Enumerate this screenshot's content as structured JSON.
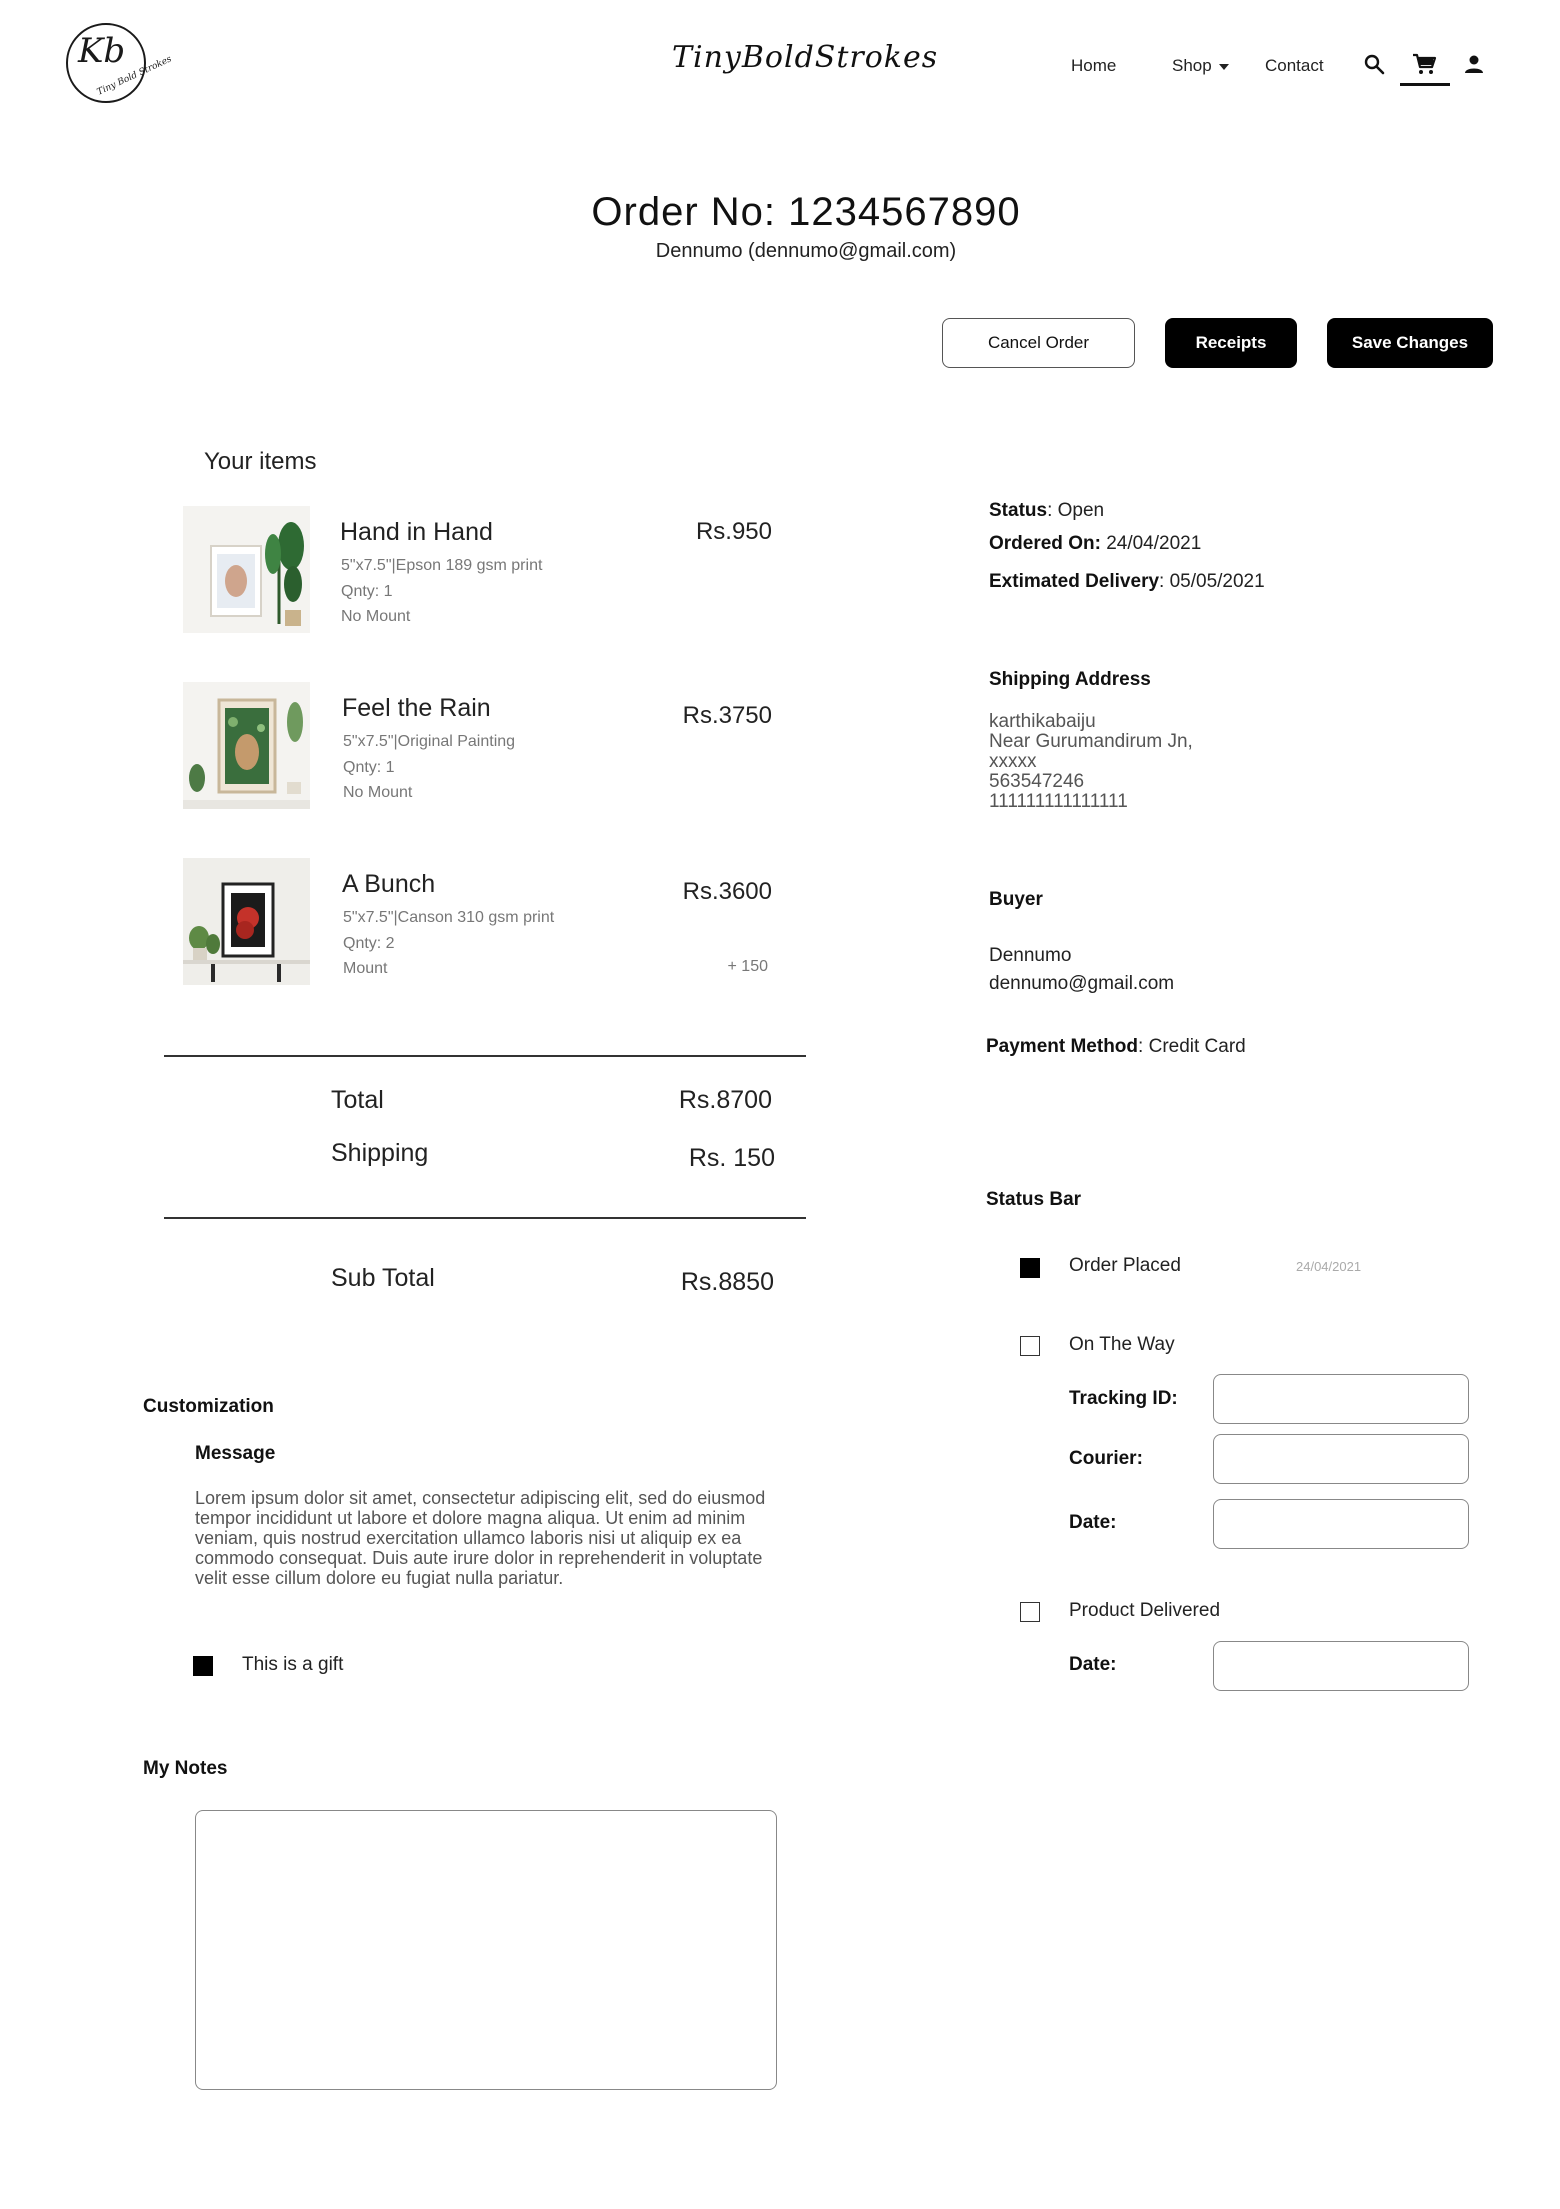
{
  "header": {
    "logo_monogram": "Kb",
    "logo_subtext": "Tiny Bold Strokes",
    "brand": "TinyBoldStrokes",
    "nav": {
      "home": "Home",
      "shop": "Shop",
      "contact": "Contact"
    },
    "icons": [
      "search-icon",
      "cart-icon",
      "user-icon"
    ]
  },
  "order": {
    "title": "Order No: 1234567890",
    "customer_line": "Dennumo (dennumo@gmail.com)"
  },
  "actions": {
    "cancel": "Cancel Order",
    "receipts": "Receipts",
    "save": "Save Changes"
  },
  "items_section": {
    "heading": "Your items",
    "items": [
      {
        "name": "Hand in Hand",
        "spec": "5\"x7.5\"|Epson 189 gsm print",
        "qty": "Qnty: 1",
        "mount": "No Mount",
        "price": "Rs.950",
        "extra": ""
      },
      {
        "name": "Feel the Rain",
        "spec": "5\"x7.5\"|Original Painting",
        "qty": "Qnty: 1",
        "mount": "No Mount",
        "price": "Rs.3750",
        "extra": ""
      },
      {
        "name": "A Bunch",
        "spec": "5\"x7.5\"|Canson 310 gsm print",
        "qty": "Qnty: 2",
        "mount": "Mount",
        "price": "Rs.3600",
        "extra": "+ 150"
      }
    ]
  },
  "totals": {
    "total_label": "Total",
    "total_value": "Rs.8700",
    "shipping_label": "Shipping",
    "shipping_value": "Rs. 150",
    "subtotal_label": "Sub Total",
    "subtotal_value": "Rs.8850"
  },
  "status_info": {
    "status_label": "Status",
    "status_value": "Open",
    "ordered_label": "Ordered On:",
    "ordered_value": "24/04/2021",
    "delivery_label": "Extimated Delivery",
    "delivery_value": "05/05/2021"
  },
  "shipping_address": {
    "heading": "Shipping Address",
    "name": "karthikabaiju",
    "line1": "Near Gurumandirum Jn,",
    "line2": "xxxxx",
    "pincode": "563547246",
    "phone": "111111111111111"
  },
  "buyer": {
    "heading": "Buyer",
    "name": "Dennumo",
    "email": "dennumo@gmail.com"
  },
  "payment": {
    "label": "Payment Method",
    "value": "Credit Card"
  },
  "status_bar": {
    "heading": "Status Bar",
    "order_placed": {
      "label": "Order Placed",
      "date": "24/04/2021",
      "checked": true
    },
    "on_the_way": {
      "label": "On The Way",
      "checked": false
    },
    "tracking_label": "Tracking ID:",
    "courier_label": "Courier:",
    "date_label": "Date:",
    "delivered": {
      "label": "Product Delivered",
      "checked": false
    },
    "delivered_date_label": "Date:"
  },
  "customization": {
    "heading": "Customization",
    "message_heading": "Message",
    "message": "Lorem ipsum dolor sit amet, consectetur adipiscing elit, sed do eiusmod tempor incididunt ut labore et dolore magna aliqua. Ut enim ad minim veniam, quis nostrud exercitation ullamco laboris nisi ut aliquip ex ea commodo consequat. Duis aute irure dolor in reprehenderit in voluptate velit esse cillum dolore eu fugiat nulla pariatur.",
    "gift_label": "This is a gift",
    "gift_checked": true
  },
  "notes": {
    "heading": "My Notes",
    "value": ""
  }
}
